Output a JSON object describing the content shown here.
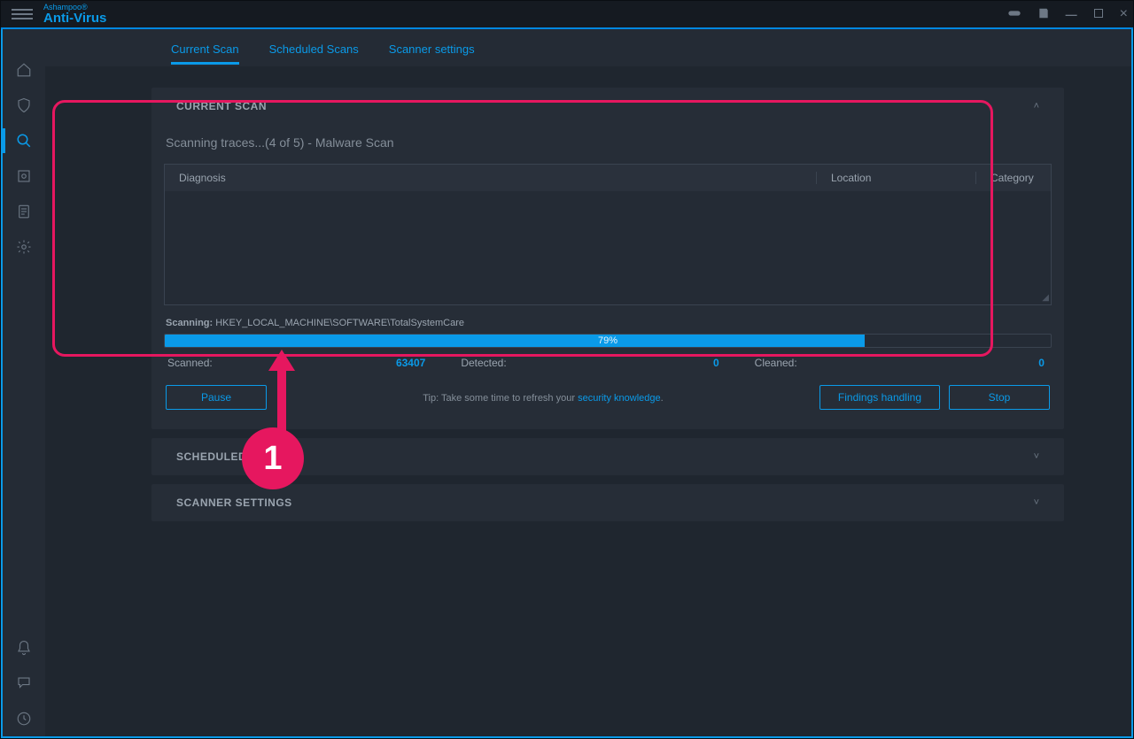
{
  "titlebar": {
    "brand_sup": "Ashampoo®",
    "brand": "Anti-Virus"
  },
  "tabs": [
    {
      "label": "Current Scan",
      "active": true
    },
    {
      "label": "Scheduled Scans",
      "active": false
    },
    {
      "label": "Scanner settings",
      "active": false
    }
  ],
  "panels": {
    "current_scan": {
      "title": "CURRENT SCAN"
    },
    "scheduled": {
      "title": "SCHEDULED SCANS"
    },
    "settings": {
      "title": "SCANNER SETTINGS"
    }
  },
  "scan": {
    "status": "Scanning traces...(4 of 5) - Malware Scan",
    "columns": {
      "diagnosis": "Diagnosis",
      "location": "Location",
      "category": "Category"
    },
    "scanning_label": "Scanning:",
    "scanning_path": "HKEY_LOCAL_MACHINE\\SOFTWARE\\TotalSystemCare",
    "progress_pct": 79,
    "progress_label": "79%",
    "stats": {
      "scanned_label": "Scanned:",
      "scanned_value": "63407",
      "detected_label": "Detected:",
      "detected_value": "0",
      "cleaned_label": "Cleaned:",
      "cleaned_value": "0"
    }
  },
  "actions": {
    "pause": "Pause",
    "tip_prefix": "Tip: Take some time to refresh your ",
    "tip_link": "security knowledge",
    "tip_suffix": ".",
    "findings": "Findings handling",
    "stop": "Stop"
  },
  "annotation": {
    "badge": "1"
  }
}
